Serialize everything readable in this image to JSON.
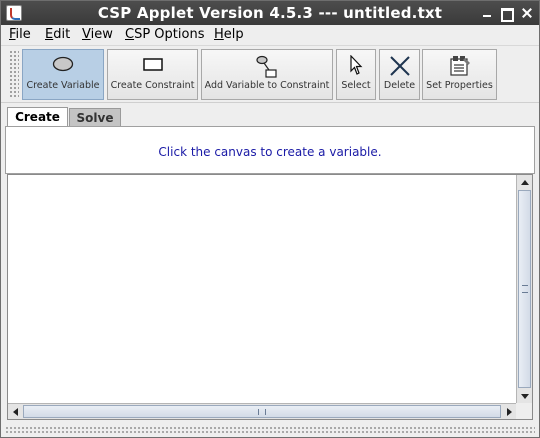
{
  "window": {
    "title": "CSP Applet Version 4.5.3 --- untitled.txt"
  },
  "menu": {
    "items": [
      {
        "label": "File",
        "mnemonic": "F",
        "rest": "ile"
      },
      {
        "label": "Edit",
        "mnemonic": "E",
        "rest": "dit"
      },
      {
        "label": "View",
        "mnemonic": "V",
        "rest": "iew"
      },
      {
        "label": "CSP Options",
        "mnemonic": "C",
        "rest": "SP Options"
      },
      {
        "label": "Help",
        "mnemonic": "H",
        "rest": "elp"
      }
    ]
  },
  "toolbar": {
    "buttons": [
      {
        "label": "Create Variable",
        "icon": "ellipse-icon",
        "active": true
      },
      {
        "label": "Create Constraint",
        "icon": "rectangle-icon",
        "active": false
      },
      {
        "label": "Add Variable to Constraint",
        "icon": "connect-icon",
        "active": false
      },
      {
        "label": "Select",
        "icon": "pointer-icon",
        "active": false
      },
      {
        "label": "Delete",
        "icon": "x-icon",
        "active": false
      },
      {
        "label": "Set Properties",
        "icon": "properties-icon",
        "active": false
      }
    ]
  },
  "tabs": [
    {
      "label": "Create",
      "selected": true
    },
    {
      "label": "Solve",
      "selected": false
    }
  ],
  "message": "Click the canvas to create a variable."
}
